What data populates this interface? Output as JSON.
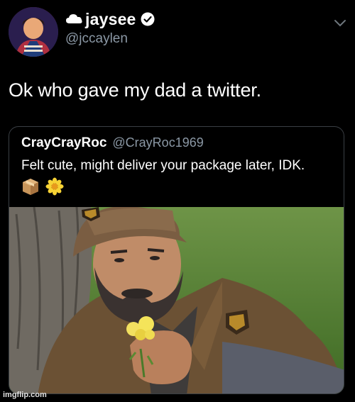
{
  "tweet": {
    "display_name": "jaysee",
    "handle": "@jccaylen",
    "text": "Ok who gave my dad a twitter."
  },
  "quoted_tweet": {
    "display_name": "CrayCrayRoc",
    "handle": "@CrayRoc1969",
    "text": "Felt cute, might deliver your package later, IDK.",
    "emojis": [
      "package-emoji",
      "blossom-emoji"
    ]
  },
  "watermark": "imgflip.com",
  "colors": {
    "background": "#000000",
    "text_primary": "#ffffff",
    "text_secondary": "#8b98a5",
    "verified": "#ffffff",
    "border": "#3a3f44"
  }
}
